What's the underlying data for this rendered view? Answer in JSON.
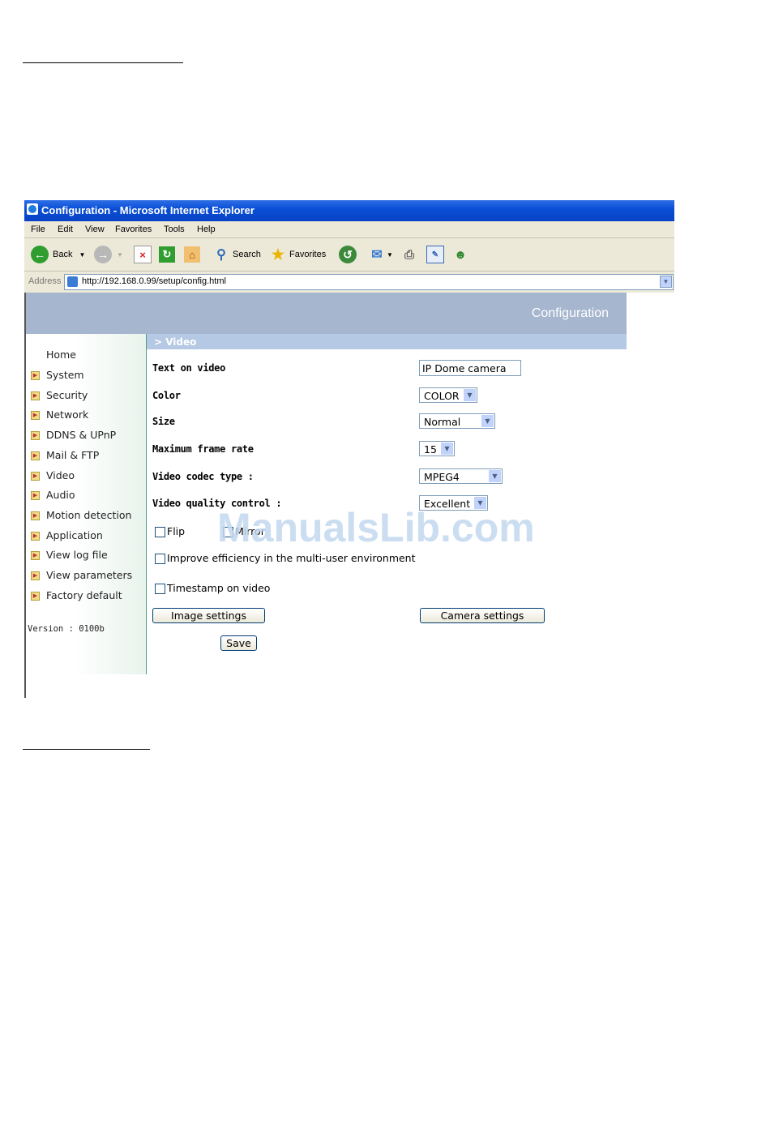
{
  "window": {
    "title": "Configuration - Microsoft Internet Explorer"
  },
  "menu": [
    "File",
    "Edit",
    "View",
    "Favorites",
    "Tools",
    "Help"
  ],
  "toolbar": {
    "back": "Back",
    "search": "Search",
    "favorites": "Favorites"
  },
  "address": {
    "label": "Address",
    "url": "http://192.168.0.99/setup/config.html"
  },
  "page": {
    "header": "Configuration",
    "section": "> Video"
  },
  "sidebar": {
    "items": [
      "Home",
      "System",
      "Security",
      "Network",
      "DDNS & UPnP",
      "Mail & FTP",
      "Video",
      "Audio",
      "Motion detection",
      "Application",
      "View log file",
      "View parameters",
      "Factory default"
    ],
    "version": "Version : 0100b"
  },
  "form": {
    "text_on_video_label": "Text on video",
    "text_on_video_value": "IP Dome camera",
    "color_label": "Color",
    "color_value": "COLOR",
    "size_label": "Size",
    "size_value": "Normal",
    "fps_label": "Maximum frame rate",
    "fps_value": "15",
    "codec_label": "Video codec type :",
    "codec_value": "MPEG4",
    "quality_label": "Video quality control :",
    "quality_value": "Excellent",
    "flip_label": "Flip",
    "mirror_label": "Mirror",
    "improve_label": "Improve efficiency in the multi-user environment",
    "timestamp_label": "Timestamp on video",
    "image_settings": "Image settings",
    "camera_settings": "Camera settings",
    "save": "Save"
  },
  "watermark": "ManualsLib.com"
}
